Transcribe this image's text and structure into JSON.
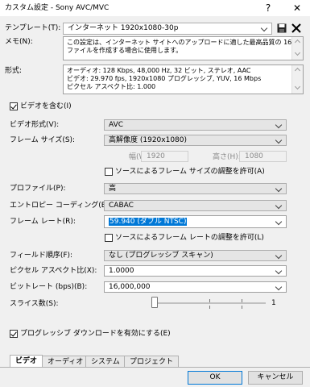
{
  "window": {
    "title": "カスタム設定 - Sony AVC/MVC",
    "help_label": "?",
    "close_label": "✕"
  },
  "template": {
    "label": "テンプレート(T):",
    "value": "インターネット 1920x1080-30p"
  },
  "memo": {
    "label": "メモ(N):",
    "lines": [
      "この設定は、インターネット サイトへのアップロードに適した最高品質の 16:9",
      "ファイルを作成する場合に使用します。"
    ]
  },
  "format": {
    "label": "形式:",
    "lines": [
      "オーディオ: 128 Kbps, 48,000 Hz, 32 ビット, ステレオ, AAC",
      "ビデオ: 29.970 fps, 1920x1080 プログレッシブ, YUV, 16 Mbps",
      "ピクセル アスペクト比: 1.000"
    ]
  },
  "include_video": {
    "label": "ビデオを含む(I)",
    "checked": true
  },
  "video_format": {
    "label": "ビデオ形式(V):",
    "value": "AVC"
  },
  "frame_size": {
    "label": "フレーム サイズ(S):",
    "value": "高解像度 (1920x1080)"
  },
  "width": {
    "label": "幅(W):",
    "value": "1920"
  },
  "height": {
    "label": "高さ(H):",
    "value": "1080"
  },
  "allow_frame_size": {
    "label": "ソースによるフレーム サイズの調整を許可(A)",
    "checked": false
  },
  "profile": {
    "label": "プロファイル(P):",
    "value": "高"
  },
  "entropy": {
    "label": "エントロピー コーディング(E):",
    "value": "CABAC"
  },
  "frame_rate": {
    "label": "フレーム レート(R):",
    "value": "59.940 (ダブル NTSC)"
  },
  "allow_frame_rate": {
    "label": "ソースによるフレーム レートの調整を許可(L)",
    "checked": false
  },
  "field_order": {
    "label": "フィールド順序(F):",
    "value": "なし (プログレッシブ スキャン)"
  },
  "pixel_aspect": {
    "label": "ピクセル アスペクト比(X):",
    "value": "1.0000"
  },
  "bitrate": {
    "label": "ビットレート (bps)(B):",
    "value": "16,000,000"
  },
  "slices": {
    "label": "スライス数(S):",
    "value": "1"
  },
  "progressive_download": {
    "label": "プログレッシブ ダウンロードを有効にする(E)",
    "checked": true
  },
  "tabs": [
    {
      "label": "ビデオ"
    },
    {
      "label": "オーディオ"
    },
    {
      "label": "システム"
    },
    {
      "label": "プロジェクト"
    }
  ],
  "buttons": {
    "ok": "OK",
    "cancel": "キャンセル"
  },
  "icons": {
    "save": "save-icon",
    "delete": "delete-icon"
  }
}
